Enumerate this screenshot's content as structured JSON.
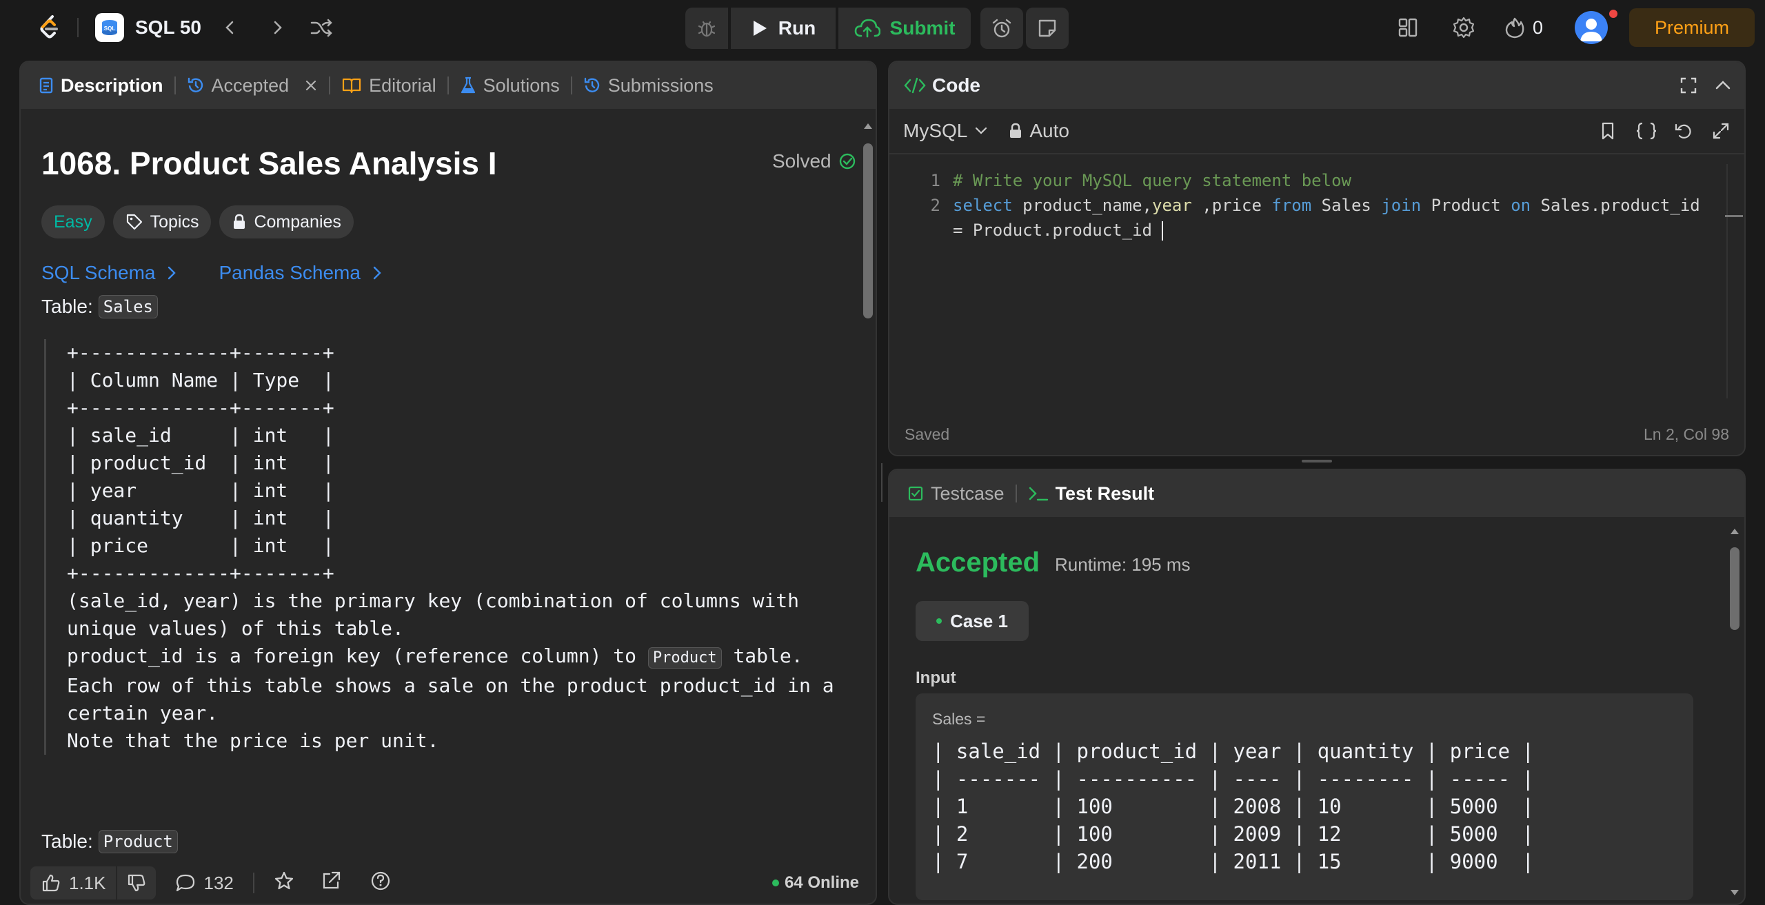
{
  "nav": {
    "problem_list_title": "SQL 50",
    "run_label": "Run",
    "submit_label": "Submit",
    "streak_count": "0",
    "premium_label": "Premium",
    "sql_badge_text": "SQL"
  },
  "description_panel": {
    "tabs": [
      {
        "label": "Description",
        "icon": "description-icon",
        "active": true
      },
      {
        "label": "Accepted",
        "icon": "history-icon",
        "active": false
      },
      {
        "label": "Editorial",
        "icon": "book-icon",
        "active": false
      },
      {
        "label": "Solutions",
        "icon": "flask-icon",
        "active": false
      },
      {
        "label": "Submissions",
        "icon": "history-icon",
        "active": false
      }
    ],
    "title": "1068. Product Sales Analysis I",
    "status": "Solved",
    "difficulty": "Easy",
    "topics_label": "Topics",
    "companies_label": "Companies",
    "schema_links": [
      "SQL Schema",
      "Pandas Schema"
    ],
    "table1_prefix": "Table:",
    "table1_name": "Sales",
    "schema_lines": [
      "+-------------+-------+",
      "| Column Name | Type  |",
      "+-------------+-------+",
      "| sale_id     | int   |",
      "| product_id  | int   |",
      "| year        | int   |",
      "| quantity    | int   |",
      "| price       | int   |",
      "+-------------+-------+"
    ],
    "notes": {
      "line1": "(sale_id, year) is the primary key (combination of columns with",
      "line2": "unique values) of this table.",
      "line3_pre": "product_id is a foreign key (reference column) to ",
      "line3_chip": "Product",
      "line3_post": " table.",
      "line4": "Each row of this table shows a sale on the product product_id in a",
      "line5": "certain year.",
      "line6": "Note that the price is per unit."
    },
    "table2_prefix": "Table:",
    "table2_name": "Product",
    "footer": {
      "likes": "1.1K",
      "comments": "132",
      "online": "64 Online"
    }
  },
  "code_panel": {
    "title": "Code",
    "language": "MySQL",
    "mode": "Auto",
    "line_numbers": [
      "1",
      "2"
    ],
    "comment_line": "# Write your MySQL query statement below",
    "code": {
      "kw_select": "select",
      "t1": " product_name,",
      "fn_year": "year",
      "t2": " ,price ",
      "kw_from": "from",
      "t3": " Sales ",
      "kw_join": "join",
      "t4": " Product ",
      "kw_on": "on",
      "t5": " Sales.product_id",
      "wrap": "= Product.product_id "
    },
    "saved_label": "Saved",
    "cursor_pos": "Ln 2, Col 98"
  },
  "test_panel": {
    "tabs": [
      {
        "label": "Testcase",
        "active": false
      },
      {
        "label": "Test Result",
        "active": true
      }
    ],
    "result": "Accepted",
    "runtime": "Runtime: 195 ms",
    "case_label": "Case 1",
    "input_label": "Input",
    "sales_eq": "Sales =",
    "input_rows": [
      "| sale_id | product_id | year | quantity | price |",
      "| ------- | ---------- | ---- | -------- | ----- |",
      "| 1       | 100        | 2008 | 10       | 5000  |",
      "| 2       | 100        | 2009 | 12       | 5000  |",
      "| 7       | 200        | 2011 | 15       | 9000  |"
    ]
  },
  "colors": {
    "accent_green": "#2cbb5d",
    "easy_teal": "#00b8a3",
    "premium_orange": "#ffa116",
    "link_blue": "#3c8cf0"
  }
}
